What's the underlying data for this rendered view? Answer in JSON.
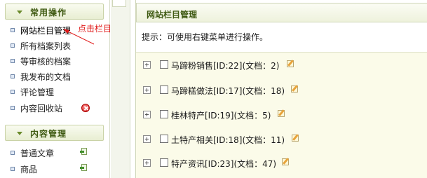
{
  "sidebar": {
    "groups": [
      {
        "title": "常用操作",
        "items": [
          {
            "label": "网站栏目管理"
          },
          {
            "label": "所有档案列表"
          },
          {
            "label": "等审核的档案"
          },
          {
            "label": "我发布的文档"
          },
          {
            "label": "评论管理"
          },
          {
            "label": "内容回收站",
            "icon": "delete-icon"
          }
        ]
      },
      {
        "title": "内容管理",
        "items": [
          {
            "label": "普通文章",
            "icon": "add-doc-icon"
          },
          {
            "label": "商品",
            "icon": "add-doc-icon"
          }
        ]
      }
    ],
    "annotation": "点击栏目管理"
  },
  "main": {
    "title": "网站栏目管理",
    "hint": "提示：可使用右键菜单进行操作。",
    "categories": [
      {
        "name": "马蹄粉销售[ID:22](文档：2)"
      },
      {
        "name": "马蹄糕做法[ID:17](文档：18)"
      },
      {
        "name": "桂林特产[ID:19](文档：5)"
      },
      {
        "name": "土特产相关[ID:18](文档：11)"
      },
      {
        "name": "特产资讯[ID:23](文档：47)"
      }
    ]
  },
  "colors": {
    "header_text": "#3f5a12",
    "annotation": "#e01818",
    "list_background": "#fbfbe9"
  }
}
